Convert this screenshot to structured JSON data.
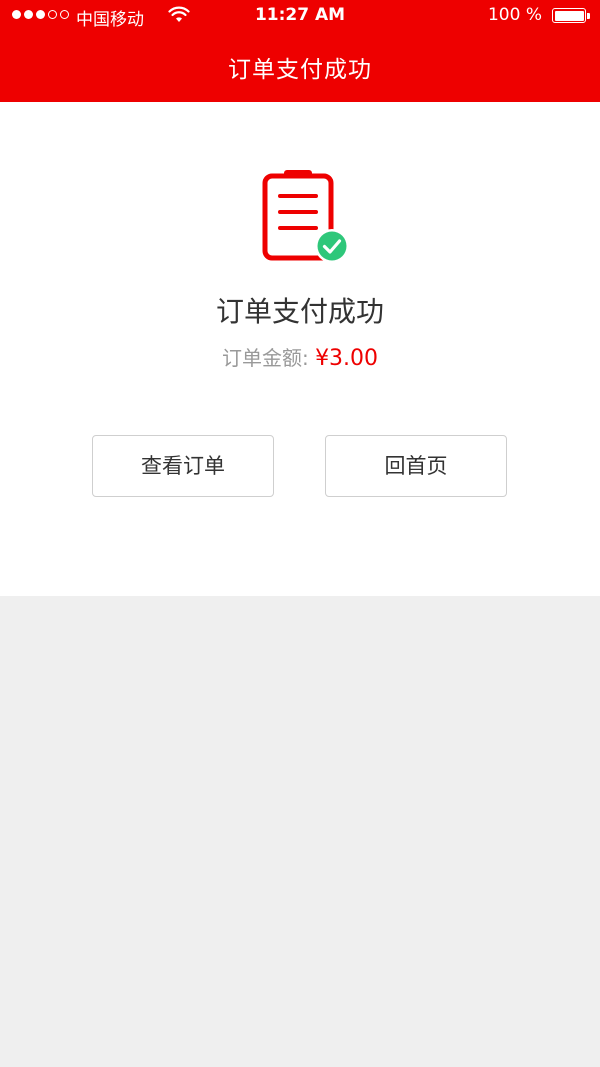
{
  "status_bar": {
    "signal_filled": 3,
    "signal_total": 5,
    "carrier": "中国移动",
    "wifi_icon": "wifi-icon",
    "time": "11:27 AM",
    "battery_text": "100 %",
    "battery_level": 1.0
  },
  "nav": {
    "title": "订单支付成功"
  },
  "result": {
    "icon": "order-success-icon",
    "title": "订单支付成功",
    "amount_label": "订单金额:",
    "amount_value": "¥3.00"
  },
  "actions": {
    "view_orders_label": "查看订单",
    "home_label": "回首页"
  },
  "colors": {
    "brand_red": "#ee0000",
    "success_green": "#2ec77a",
    "text_dark": "#333333",
    "text_gray": "#999999",
    "background": "#efefef"
  }
}
